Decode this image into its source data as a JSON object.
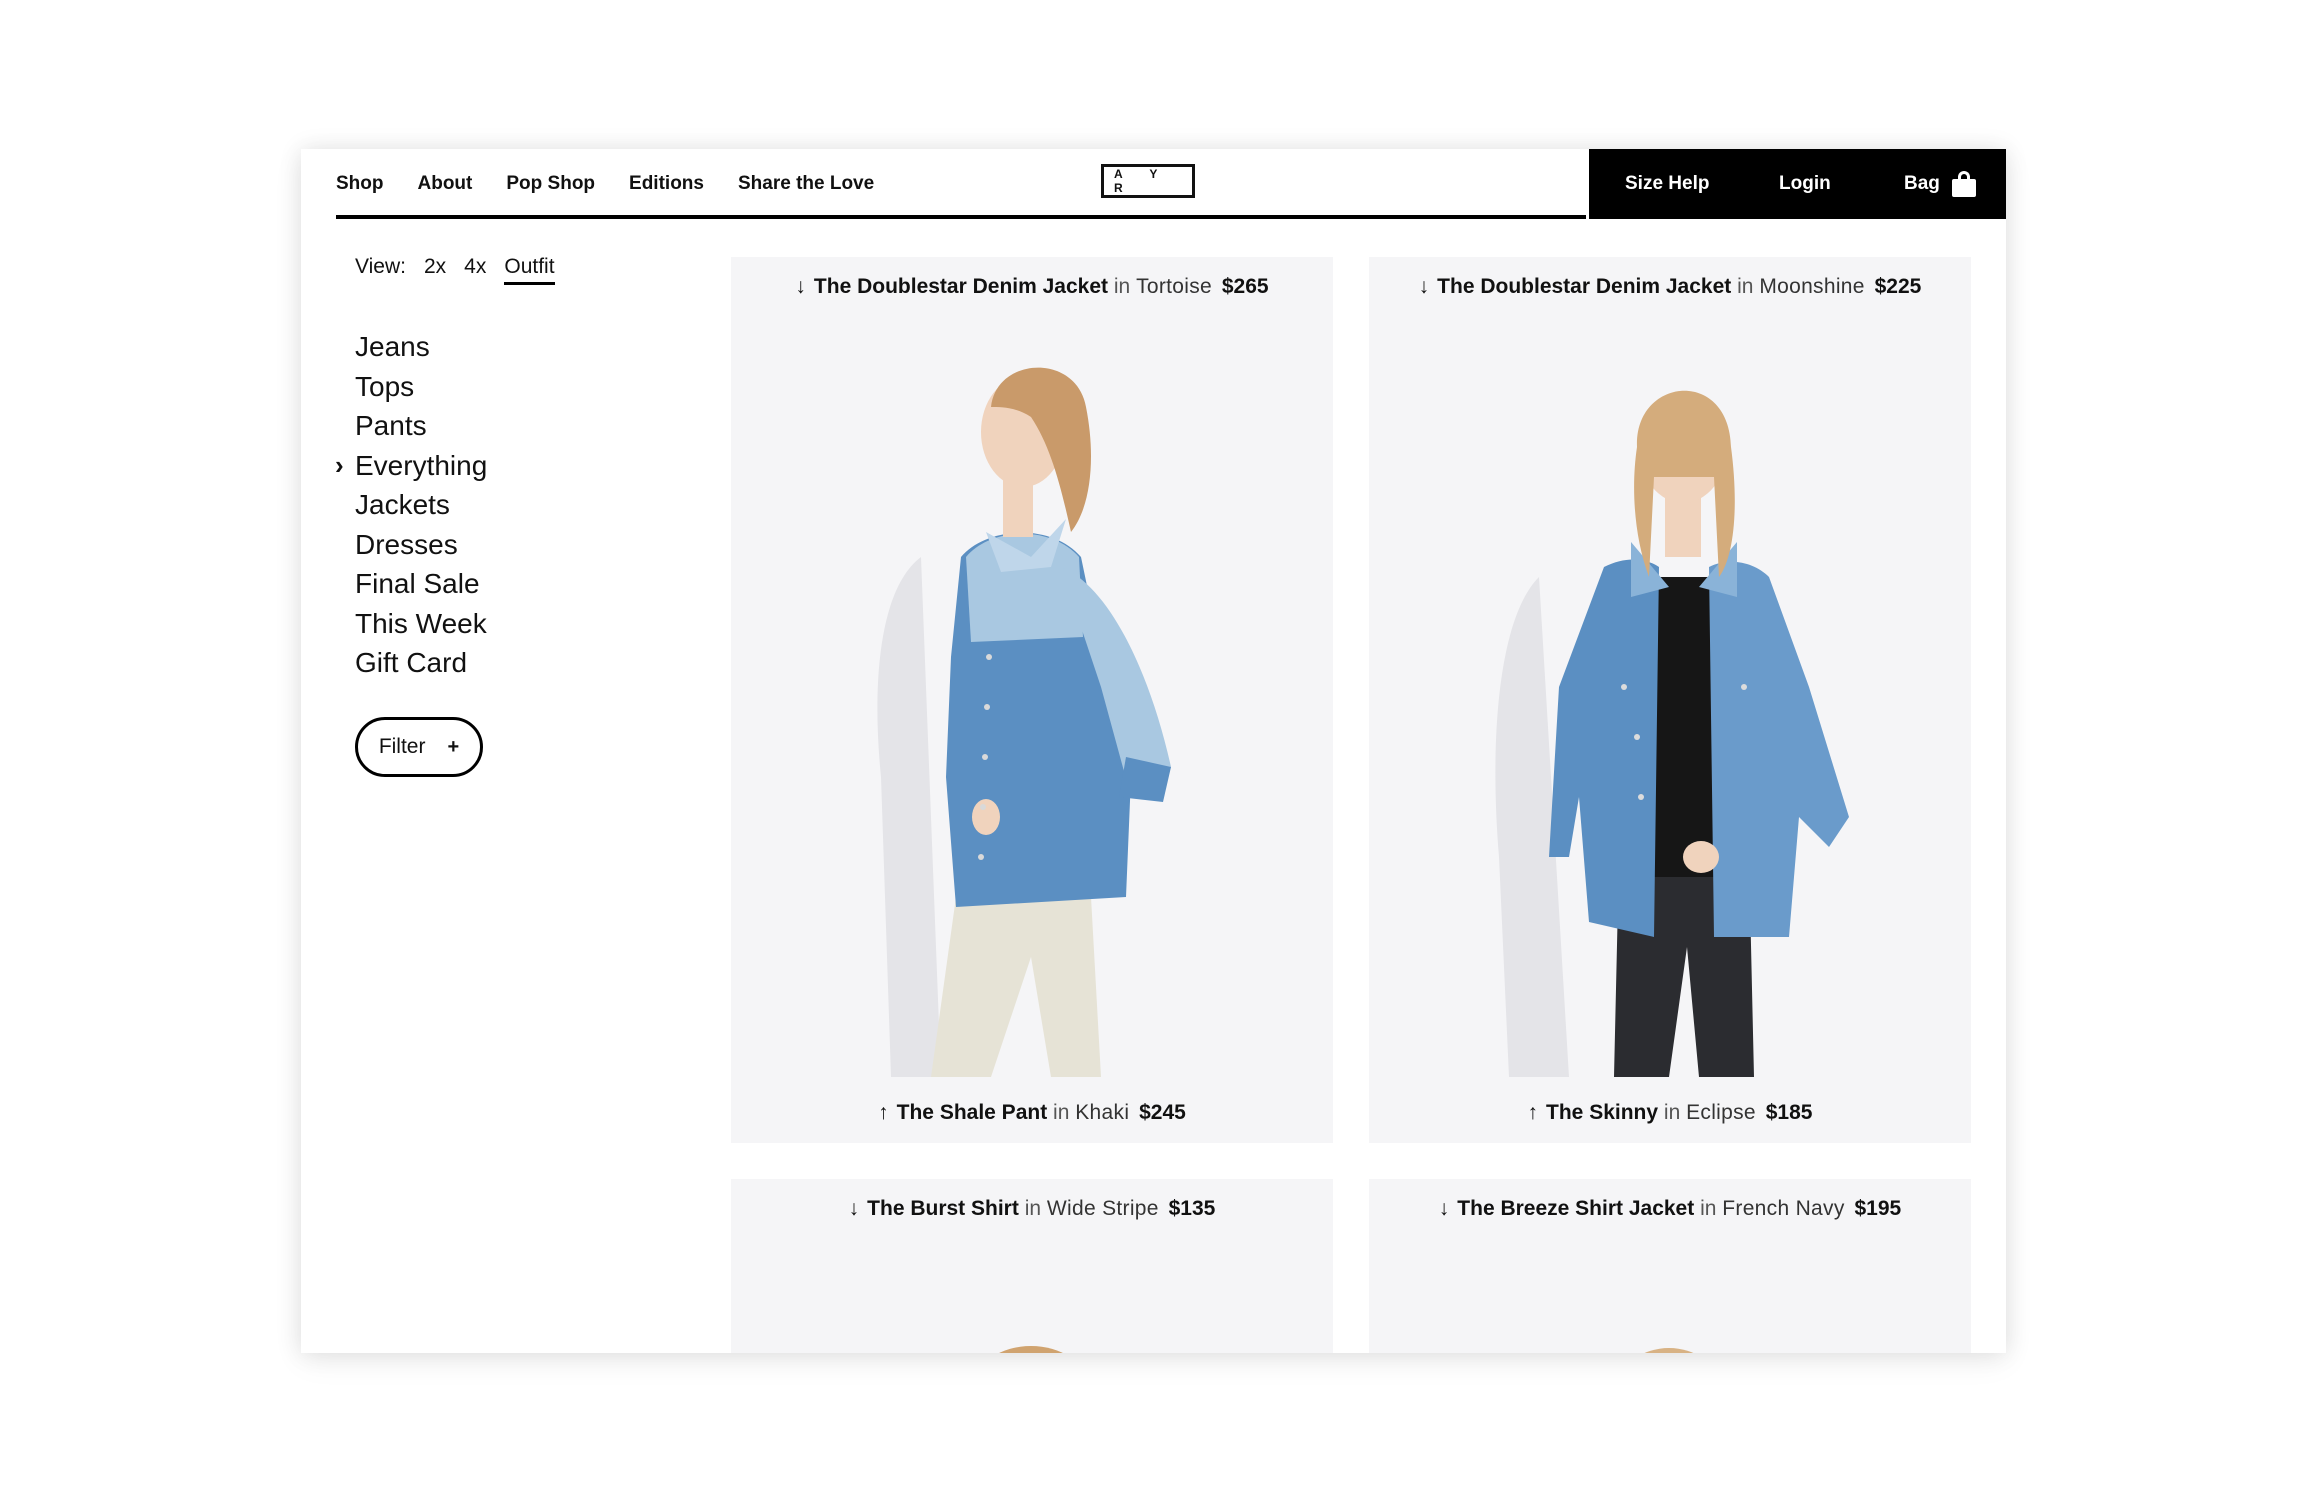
{
  "nav": {
    "links": [
      "Shop",
      "About",
      "Pop Shop",
      "Editions",
      "Share the Love"
    ],
    "logo": "A Y R",
    "size_help": "Size Help",
    "login": "Login",
    "bag": "Bag",
    "bag_icon": "shopping-bag-icon"
  },
  "sidebar": {
    "view_label": "View:",
    "view_options": [
      "2x",
      "4x",
      "Outfit"
    ],
    "active_view": "Outfit",
    "categories": [
      "Jeans",
      "Tops",
      "Pants",
      "Everything",
      "Jackets",
      "Dresses",
      "Final Sale",
      "This Week",
      "Gift Card"
    ],
    "active_category": "Everything",
    "filter_label": "Filter",
    "filter_plus": "+"
  },
  "products": [
    {
      "top": {
        "arrow": "↓",
        "name": "The Doublestar Denim Jacket",
        "in": "in",
        "color": "Tortoise",
        "price": "$265"
      },
      "bottom": {
        "arrow": "↑",
        "name": "The Shale Pant",
        "in": "in",
        "color": "Khaki",
        "price": "$245"
      }
    },
    {
      "top": {
        "arrow": "↓",
        "name": "The Doublestar Denim Jacket",
        "in": "in",
        "color": "Moonshine",
        "price": "$225"
      },
      "bottom": {
        "arrow": "↑",
        "name": "The Skinny",
        "in": "in",
        "color": "Eclipse",
        "price": "$185"
      }
    },
    {
      "top": {
        "arrow": "↓",
        "name": "The Burst Shirt",
        "in": "in",
        "color": "Wide Stripe",
        "price": "$135"
      }
    },
    {
      "top": {
        "arrow": "↓",
        "name": "The Breeze Shirt Jacket",
        "in": "in",
        "color": "French Navy",
        "price": "$195"
      }
    }
  ],
  "colors": {
    "nav_black": "#000000",
    "card_bg": "#f5f5f7",
    "denim_light": "#9fc2dd",
    "denim": "#5b8fc2",
    "khaki": "#e6e3d6",
    "black_jeans": "#2b2c30",
    "hair": "#c99a6a",
    "skin": "#f0d3bd"
  }
}
